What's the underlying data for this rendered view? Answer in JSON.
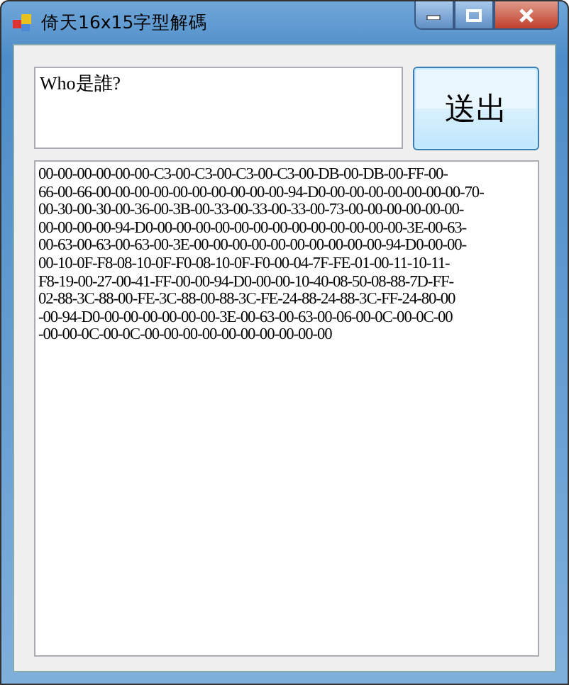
{
  "window": {
    "title": "倚天16x15字型解碼"
  },
  "input": {
    "value": "Who是誰?"
  },
  "send_button": {
    "label": "送出"
  },
  "output_lines": [
    "00-00-00-00-00-00-C3-00-C3-00-C3-00-C3-00-DB-00-DB-00-FF-00-",
    "66-00-66-00-00-00-00-00-00-00-00-00-00-94-D0-00-00-00-00-00-00-00-70-",
    "00-30-00-30-00-36-00-3B-00-33-00-33-00-33-00-73-00-00-00-00-00-00-",
    "00-00-00-00-94-D0-00-00-00-00-00-00-00-00-00-00-00-00-00-3E-00-63-",
    "00-63-00-63-00-63-00-3E-00-00-00-00-00-00-00-00-00-00-94-D0-00-00-",
    "00-10-0F-F8-08-10-0F-F0-08-10-0F-F0-00-04-7F-FE-01-00-11-10-11-",
    "F8-19-00-27-00-41-FF-00-00-94-D0-00-00-10-40-08-50-08-88-7D-FF-",
    "02-88-3C-88-00-FE-3C-88-00-88-3C-FE-24-88-24-88-3C-FF-24-80-00",
    "-00-94-D0-00-00-00-00-00-00-3E-00-63-00-63-00-06-00-0C-00-0C-00",
    "-00-00-0C-00-0C-00-00-00-00-00-00-00-00-00-00"
  ]
}
